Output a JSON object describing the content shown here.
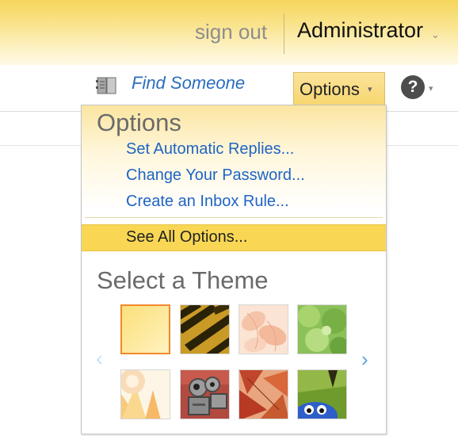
{
  "header": {
    "sign_out": "sign out",
    "user_name": "Administrator",
    "user_caret": "⌄"
  },
  "toolbar": {
    "find_someone": "Find Someone",
    "options_label": "Options",
    "options_caret": "▾",
    "help_glyph": "?",
    "help_caret": "▾"
  },
  "options_menu": {
    "title": "Options",
    "items": [
      {
        "label": "Set Automatic Replies..."
      },
      {
        "label": "Change Your Password..."
      },
      {
        "label": "Create an Inbox Rule..."
      }
    ],
    "see_all": "See All Options...",
    "theme_title": "Select a Theme",
    "prev_arrow": "‹",
    "next_arrow": "›",
    "themes": [
      {
        "name": "default-yellow",
        "selected": true
      },
      {
        "name": "zebra-stripes",
        "selected": false
      },
      {
        "name": "peach-petals",
        "selected": false
      },
      {
        "name": "green-leaves",
        "selected": false
      },
      {
        "name": "sunrise-rays",
        "selected": false
      },
      {
        "name": "robots",
        "selected": false
      },
      {
        "name": "autumn-leaves",
        "selected": false
      },
      {
        "name": "blue-creature",
        "selected": false
      }
    ]
  },
  "colors": {
    "accent_yellow": "#f9d754",
    "link_blue": "#1f64c4",
    "selected_border": "#f08a2c"
  }
}
